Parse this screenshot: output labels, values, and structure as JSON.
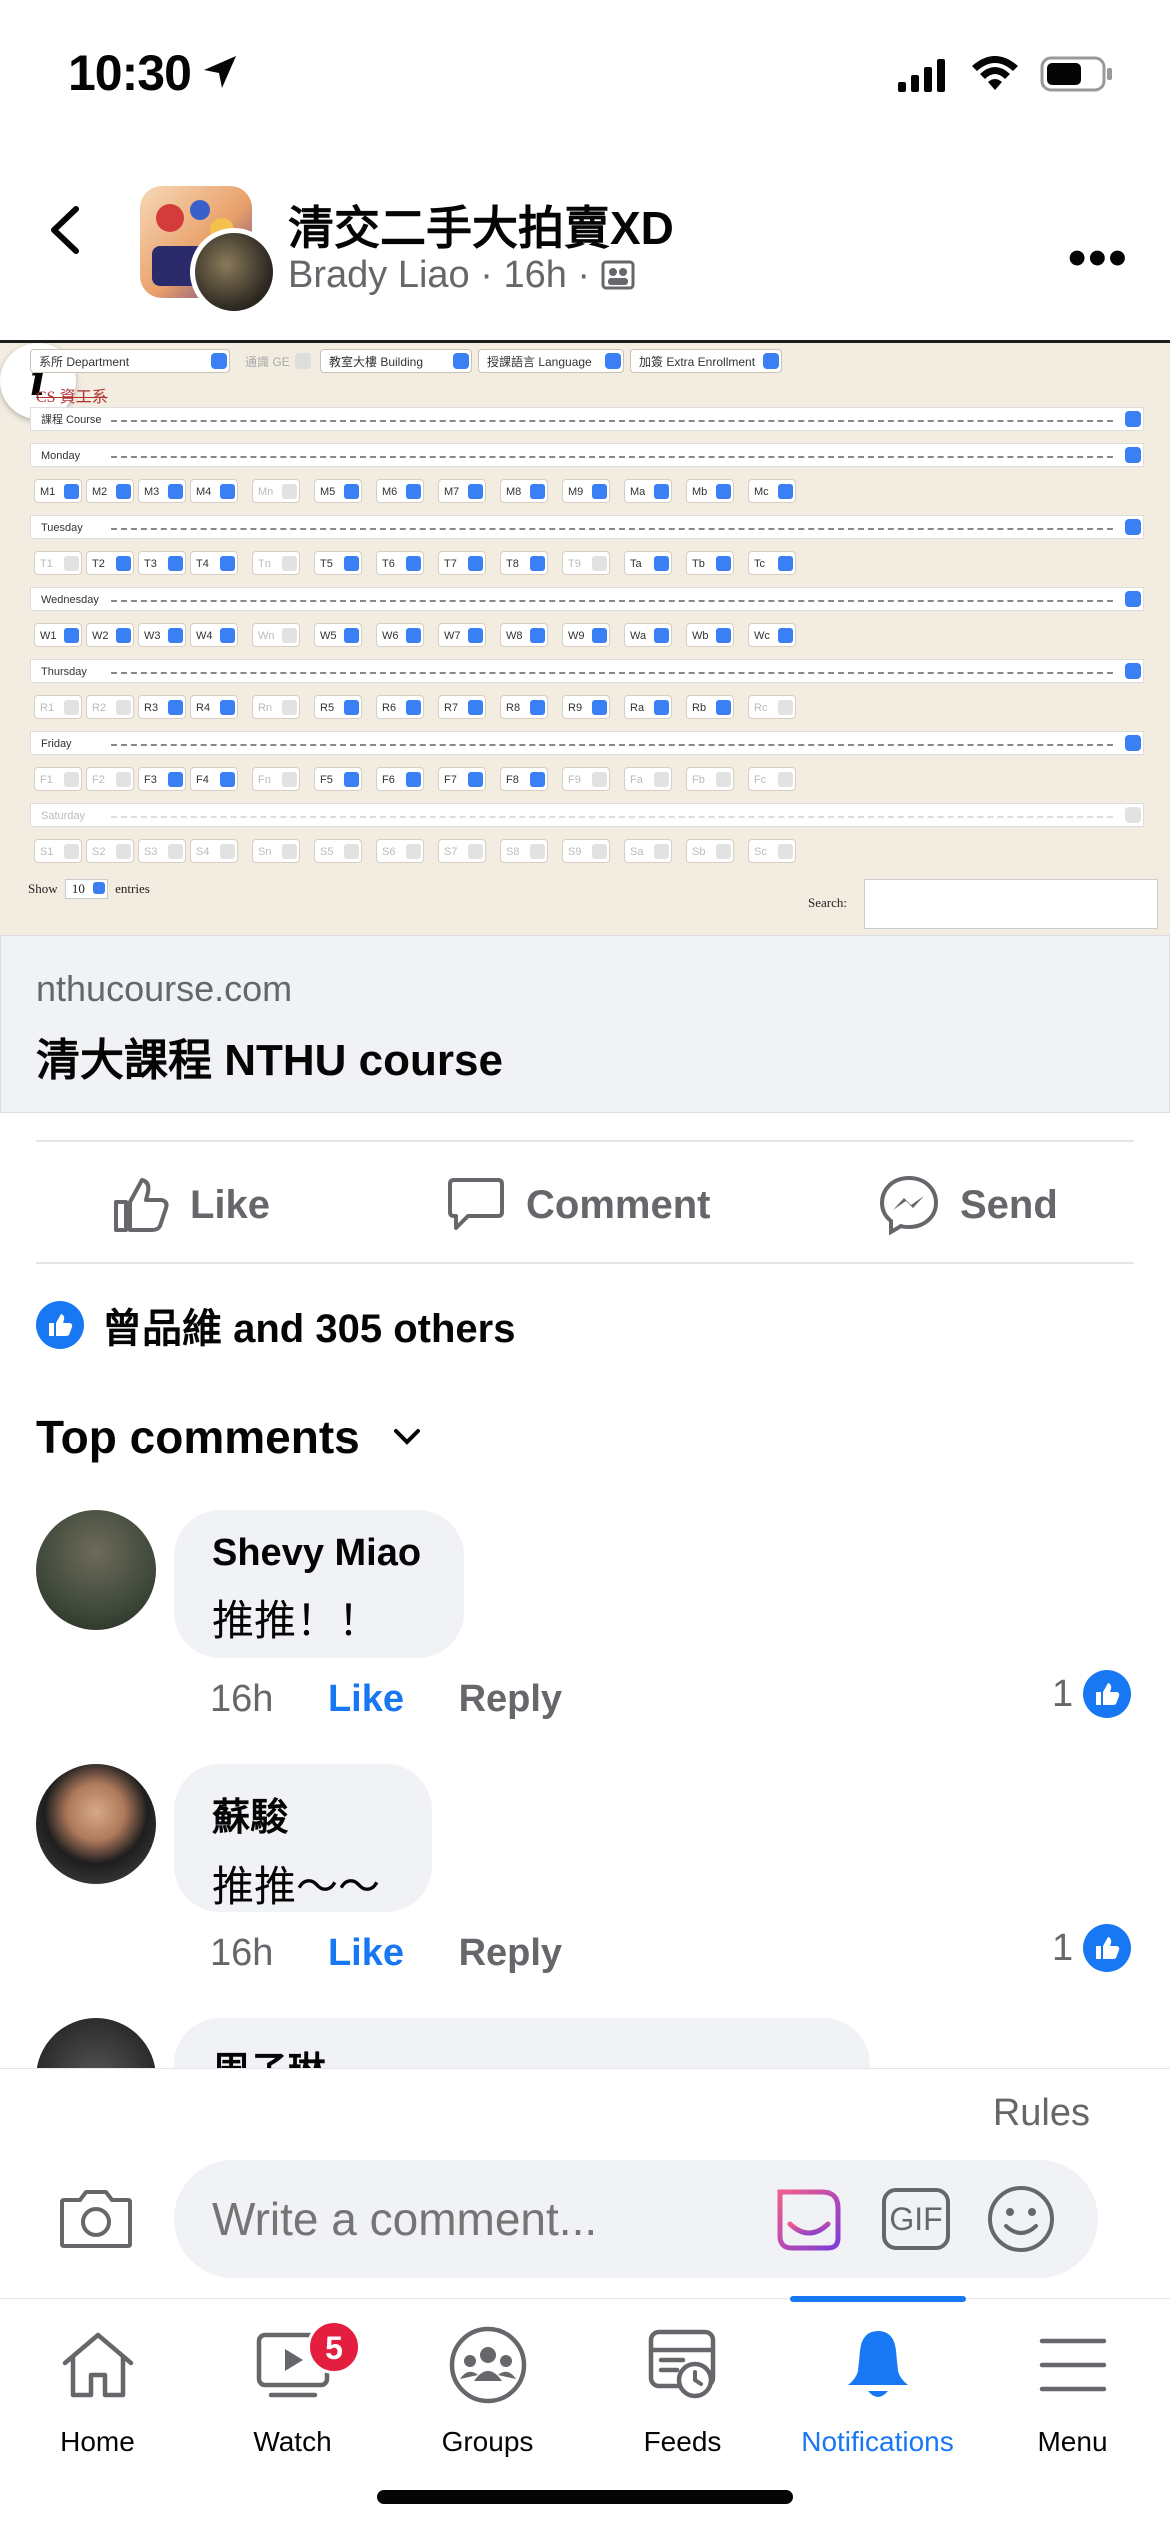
{
  "status_bar": {
    "time": "10:30"
  },
  "post": {
    "group_name": "清交二手大拍賣XD",
    "author": "Brady Liao",
    "time": "16h",
    "link": {
      "domain": "nthucourse.com",
      "title": "清大課程 NTHU course",
      "preview": {
        "selects": [
          "系所 Department",
          "通識 GE",
          "教室大樓 Building",
          "授課語言 Language",
          "加簽 Extra Enrollment"
        ],
        "dept_value": "CS 資工系",
        "course_label": "課程 Course",
        "days": [
          "Monday",
          "Tuesday",
          "Wednesday",
          "Thursday",
          "Friday",
          "Saturday"
        ],
        "monday": [
          "M1",
          "M2",
          "M3",
          "M4",
          "Mn",
          "M5",
          "M6",
          "M7",
          "M8",
          "M9",
          "Ma",
          "Mb",
          "Mc"
        ],
        "tuesday": [
          "T1",
          "T2",
          "T3",
          "T4",
          "Tn",
          "T5",
          "T6",
          "T7",
          "T8",
          "T9",
          "Ta",
          "Tb",
          "Tc"
        ],
        "wednesday": [
          "W1",
          "W2",
          "W3",
          "W4",
          "Wn",
          "W5",
          "W6",
          "W7",
          "W8",
          "W9",
          "Wa",
          "Wb",
          "Wc"
        ],
        "thursday": [
          "R1",
          "R2",
          "R3",
          "R4",
          "Rn",
          "R5",
          "R6",
          "R7",
          "R8",
          "R9",
          "Ra",
          "Rb",
          "Rc"
        ],
        "friday": [
          "F1",
          "F2",
          "F3",
          "F4",
          "Fn",
          "F5",
          "F6",
          "F7",
          "F8",
          "F9",
          "Fa",
          "Fb",
          "Fc"
        ],
        "saturday": [
          "S1",
          "S2",
          "S3",
          "S4",
          "Sn",
          "S5",
          "S6",
          "S7",
          "S8",
          "S9",
          "Sa",
          "Sb",
          "Sc"
        ],
        "show_label": "Show",
        "show_value": "10",
        "entries_label": "entries",
        "search_label": "Search:"
      }
    },
    "actions": {
      "like": "Like",
      "comment": "Comment",
      "send": "Send"
    },
    "reactions_text": "曾品維 and 305 others",
    "top_comments_label": "Top comments",
    "comments": [
      {
        "name": "Shevy Miao",
        "text": "推推！！",
        "time": "16h",
        "like": "Like",
        "reply": "Reply",
        "likes": "1"
      },
      {
        "name": "蘇駿",
        "text": "推推～～",
        "time": "16h",
        "like": "Like",
        "reply": "Reply",
        "likes": "1"
      },
      {
        "name": "周子琳",
        "text": ""
      }
    ]
  },
  "composer": {
    "rules": "Rules",
    "placeholder": "Write a comment...",
    "gif": "GIF"
  },
  "tabs": [
    {
      "label": "Home",
      "icon": "home-icon"
    },
    {
      "label": "Watch",
      "icon": "watch-icon",
      "badge": "5"
    },
    {
      "label": "Groups",
      "icon": "groups-icon"
    },
    {
      "label": "Feeds",
      "icon": "feeds-icon"
    },
    {
      "label": "Notifications",
      "icon": "bell-icon",
      "active": true
    },
    {
      "label": "Menu",
      "icon": "menu-icon"
    }
  ],
  "colors": {
    "accent": "#1877f2",
    "badge": "#e41e3f",
    "muted": "#65676b"
  }
}
